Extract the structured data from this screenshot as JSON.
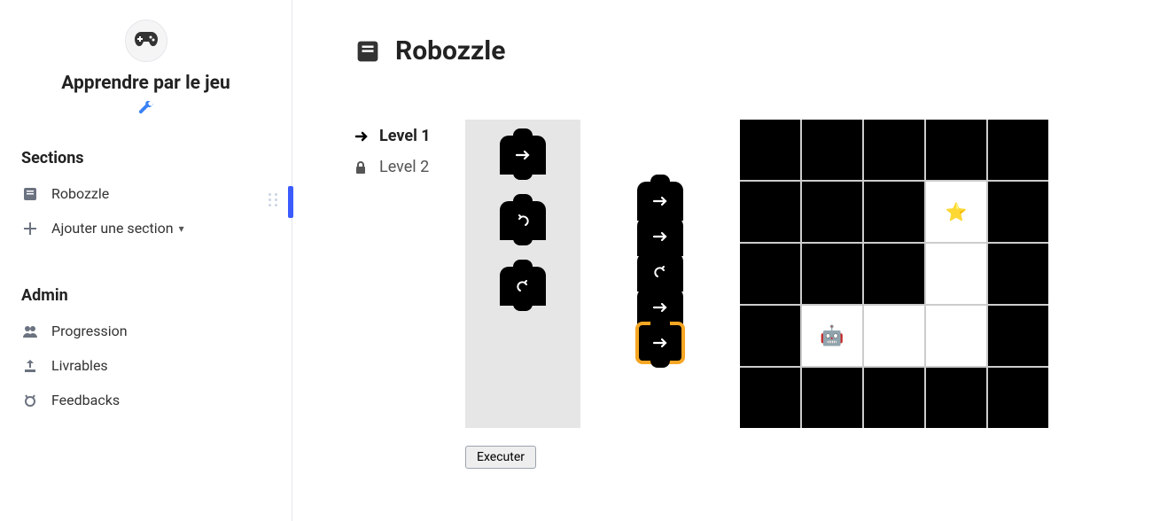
{
  "site": {
    "title": "Apprendre par le jeu"
  },
  "sidebar": {
    "sections_heading": "Sections",
    "sections": [
      {
        "icon": "book",
        "label": "Robozzle",
        "active": true
      },
      {
        "icon": "plus",
        "label": "Ajouter une section",
        "dropdown": true
      }
    ],
    "admin_heading": "Admin",
    "admin": [
      {
        "icon": "users",
        "label": "Progression"
      },
      {
        "icon": "upload",
        "label": "Livrables"
      },
      {
        "icon": "target",
        "label": "Feedbacks"
      }
    ]
  },
  "page": {
    "title": "Robozzle"
  },
  "levels": [
    {
      "label": "Level 1",
      "state": "active"
    },
    {
      "label": "Level 2",
      "state": "locked"
    }
  ],
  "palette_blocks": [
    "forward",
    "turn-left",
    "turn-right"
  ],
  "program_blocks": [
    "forward",
    "forward",
    "turn-right",
    "forward",
    "forward"
  ],
  "program_highlight_index": 4,
  "board": {
    "cols": 5,
    "rows": 5,
    "white_cells": [
      [
        3,
        1
      ],
      [
        3,
        2
      ],
      [
        3,
        3
      ],
      [
        2,
        3
      ],
      [
        1,
        3
      ]
    ],
    "star_cell": [
      3,
      1
    ],
    "robot_cell": [
      1,
      3
    ]
  },
  "buttons": {
    "execute": "Executer"
  }
}
